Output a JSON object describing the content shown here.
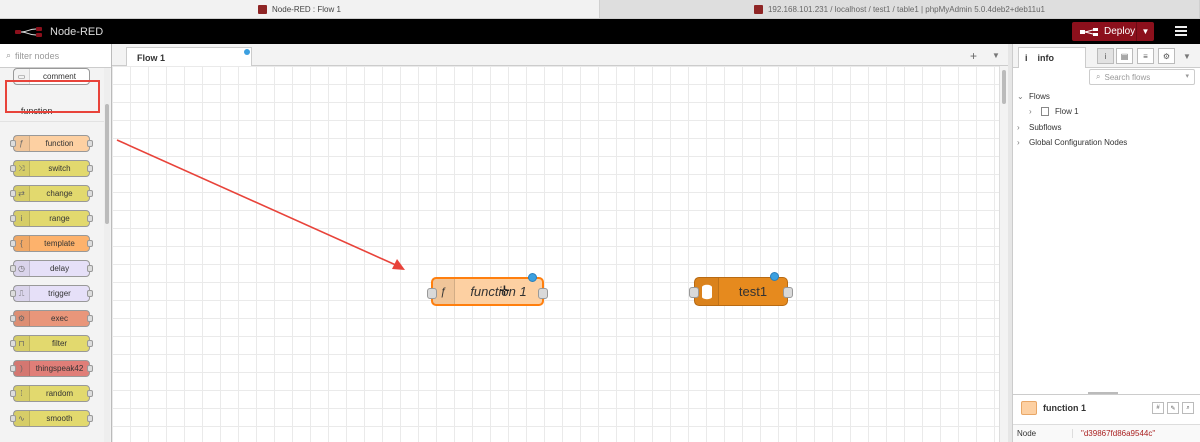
{
  "browser_tabs": [
    {
      "title": "Node-RED : Flow 1",
      "active": true
    },
    {
      "title": "192.168.101.231 / localhost / test1 / table1 | phpMyAdmin 5.0.4deb2+deb11u1",
      "active": false
    }
  ],
  "header": {
    "app_name": "Node-RED",
    "deploy_label": "Deploy"
  },
  "palette": {
    "filter_placeholder": "filter nodes",
    "top_node": "comment",
    "category": "function",
    "nodes": [
      {
        "label": "function",
        "color": "#fdd0a2",
        "icon": "ƒ"
      },
      {
        "label": "switch",
        "color": "#e2d96e",
        "icon": "⤨"
      },
      {
        "label": "change",
        "color": "#e2d96e",
        "icon": "⇄"
      },
      {
        "label": "range",
        "color": "#e2d96e",
        "icon": "i"
      },
      {
        "label": "template",
        "color": "#fdb26c",
        "icon": "{"
      },
      {
        "label": "delay",
        "color": "#e6e0f8",
        "icon": "◷"
      },
      {
        "label": "trigger",
        "color": "#e6e0f8",
        "icon": "⎍"
      },
      {
        "label": "exec",
        "color": "#e9967a",
        "icon": "⚙"
      },
      {
        "label": "filter",
        "color": "#e2d96e",
        "icon": "⊓"
      },
      {
        "label": "thingspeak42",
        "color": "#e07e78",
        "icon": ")"
      },
      {
        "label": "random",
        "color": "#e2d96e",
        "icon": "⁞"
      },
      {
        "label": "smooth",
        "color": "#e2d96e",
        "icon": "∿"
      }
    ]
  },
  "workspace": {
    "tab_label": "Flow 1",
    "nodes": [
      {
        "label": "function 1",
        "color": "#fdd0a2",
        "icon": "ƒ"
      },
      {
        "label": "test1",
        "color": "#e68a1e",
        "icon": "db"
      }
    ]
  },
  "sidebar": {
    "tab_label": "info",
    "search_placeholder": "Search flows",
    "tree": {
      "flows": "Flows",
      "flow_1": "Flow 1",
      "subflows": "Subflows",
      "global_config": "Global Configuration Nodes"
    },
    "selected_node": {
      "name": "function 1",
      "prop_key": "Node",
      "prop_value": "\"d39867fd86a9544c\""
    }
  },
  "colors": {
    "accent": "#8c101c",
    "annotation": "#e8433a",
    "changed_badge": "#3ca0e0"
  }
}
